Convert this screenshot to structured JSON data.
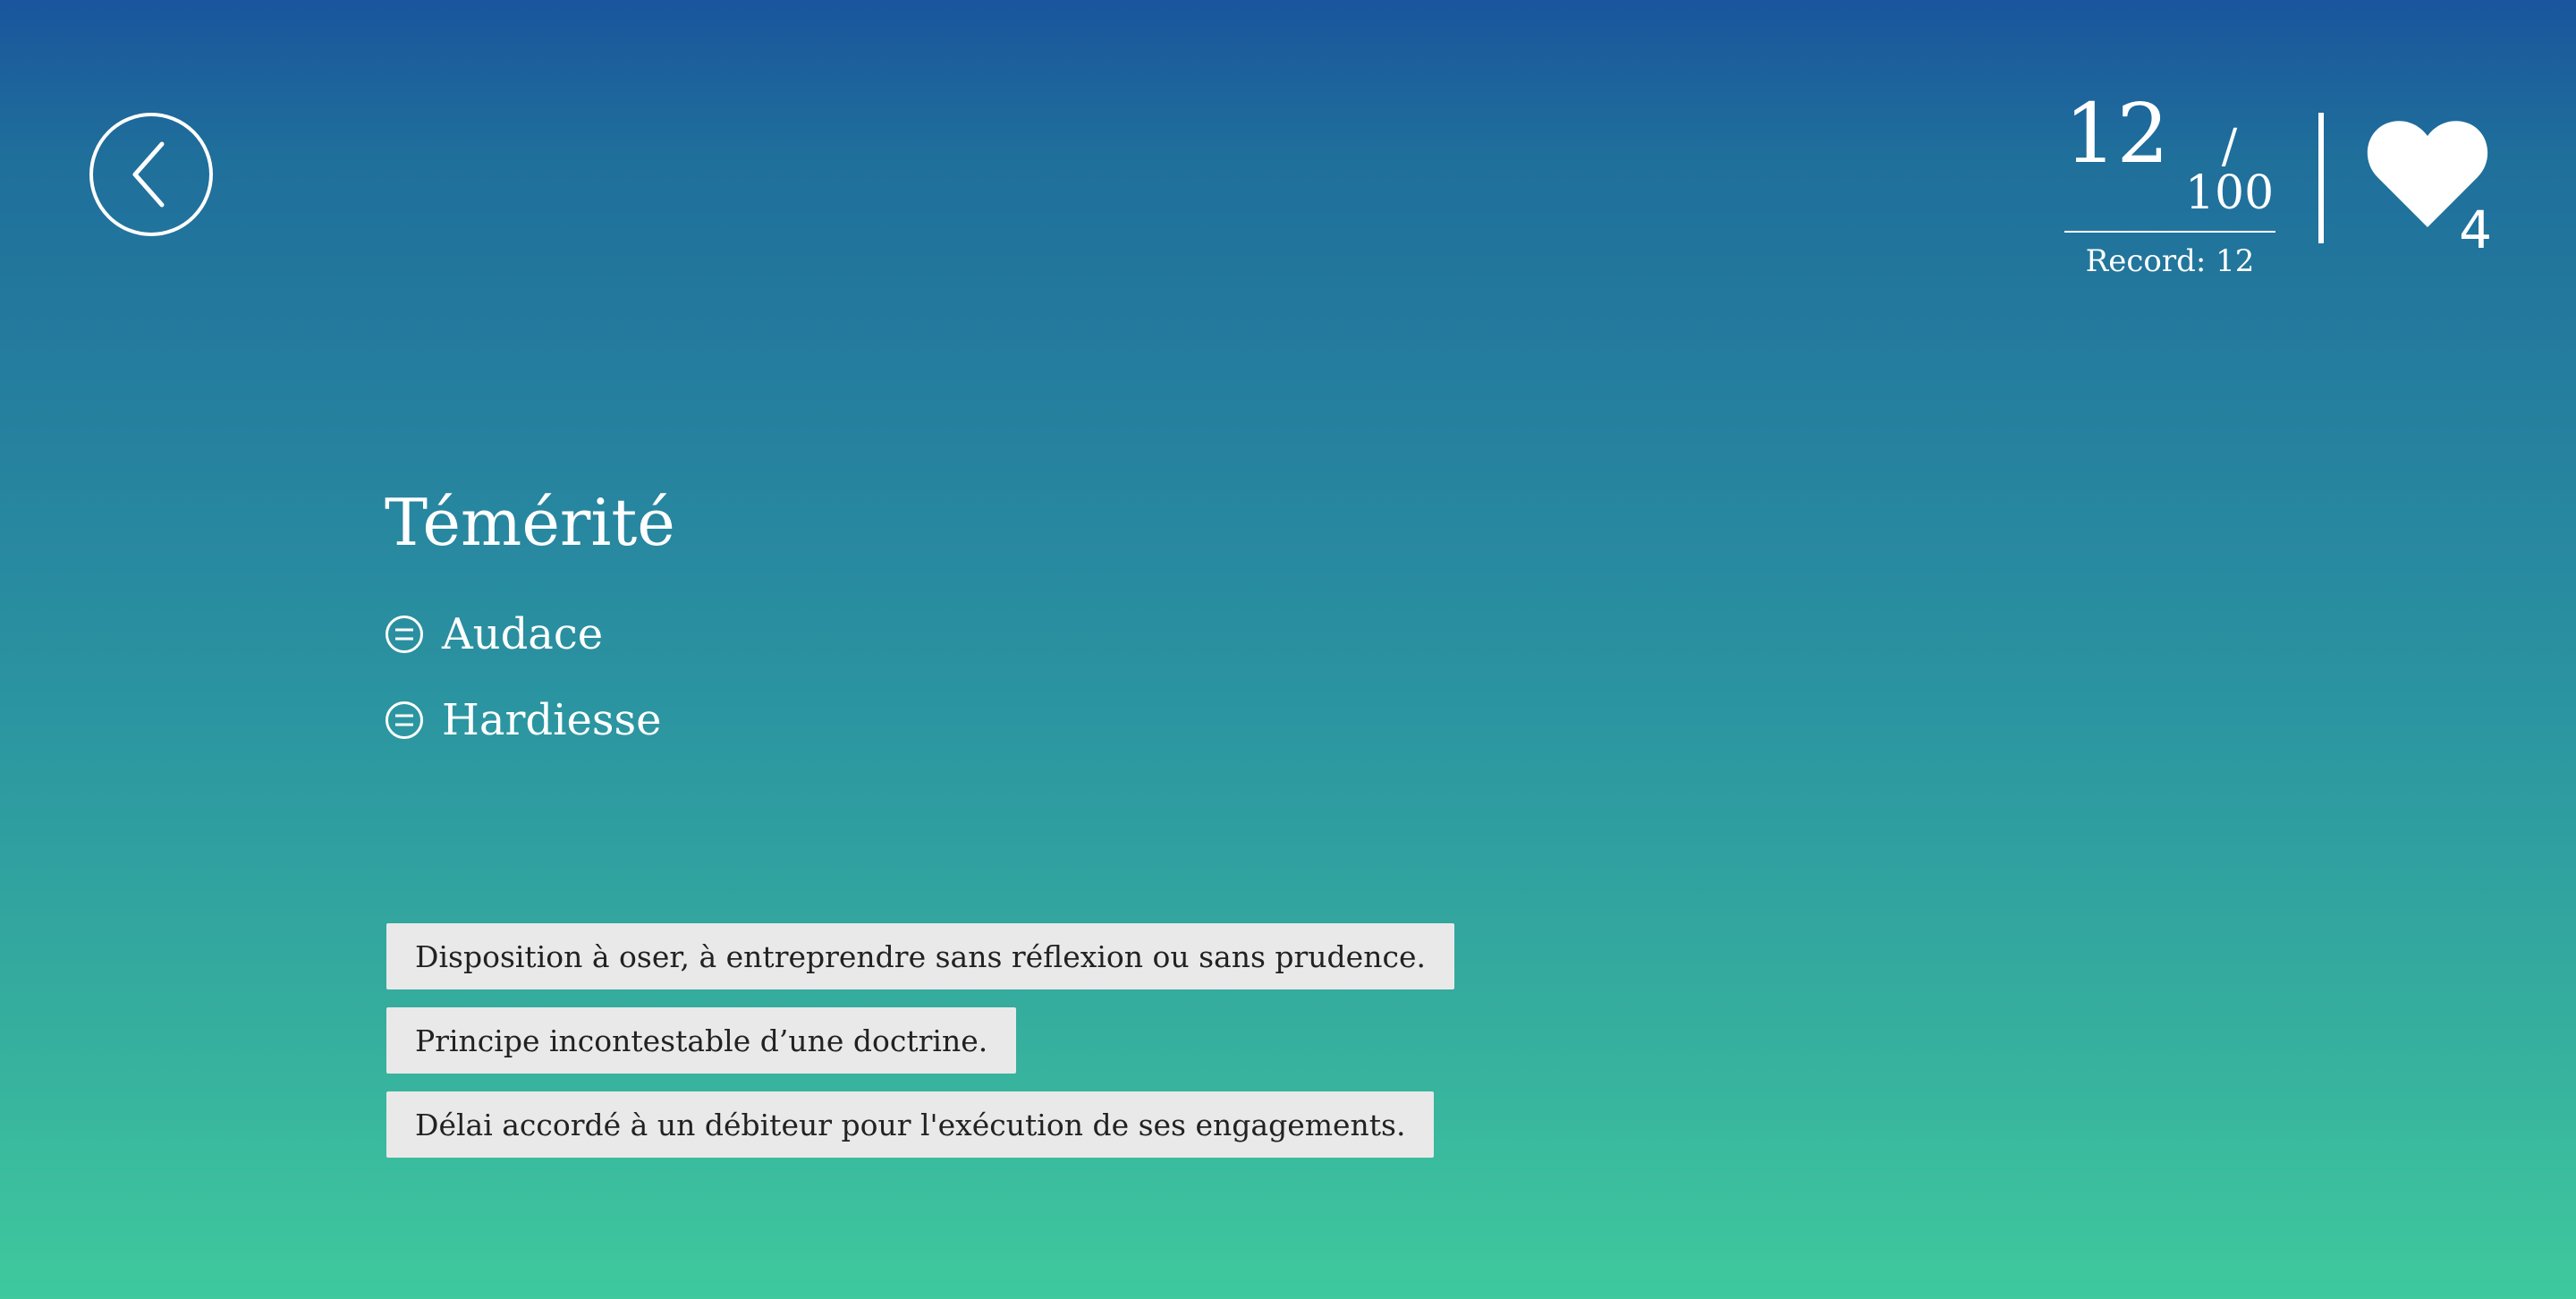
{
  "header": {
    "back_icon": "chevron-left-icon",
    "score": {
      "current": "12",
      "total": "/ 100",
      "record_label": "Record: 12"
    },
    "lives": {
      "icon": "heart-icon",
      "count": "4"
    }
  },
  "question": {
    "word": "Témérité",
    "synonyms": [
      {
        "label": "Audace",
        "icon": "equals-circle-icon"
      },
      {
        "label": "Hardiesse",
        "icon": "equals-circle-icon"
      }
    ]
  },
  "answers": [
    {
      "label": "Disposition à oser, à entreprendre sans réflexion ou sans prudence."
    },
    {
      "label": "Principe incontestable d’une doctrine."
    },
    {
      "label": "Délai accordé à un débiteur pour l'exécution de ses engagements."
    }
  ],
  "colors": {
    "gradient_top": "#1a559d",
    "gradient_bottom": "#3fc99d",
    "answer_background": "#e9e9e9",
    "answer_text": "#222222"
  }
}
